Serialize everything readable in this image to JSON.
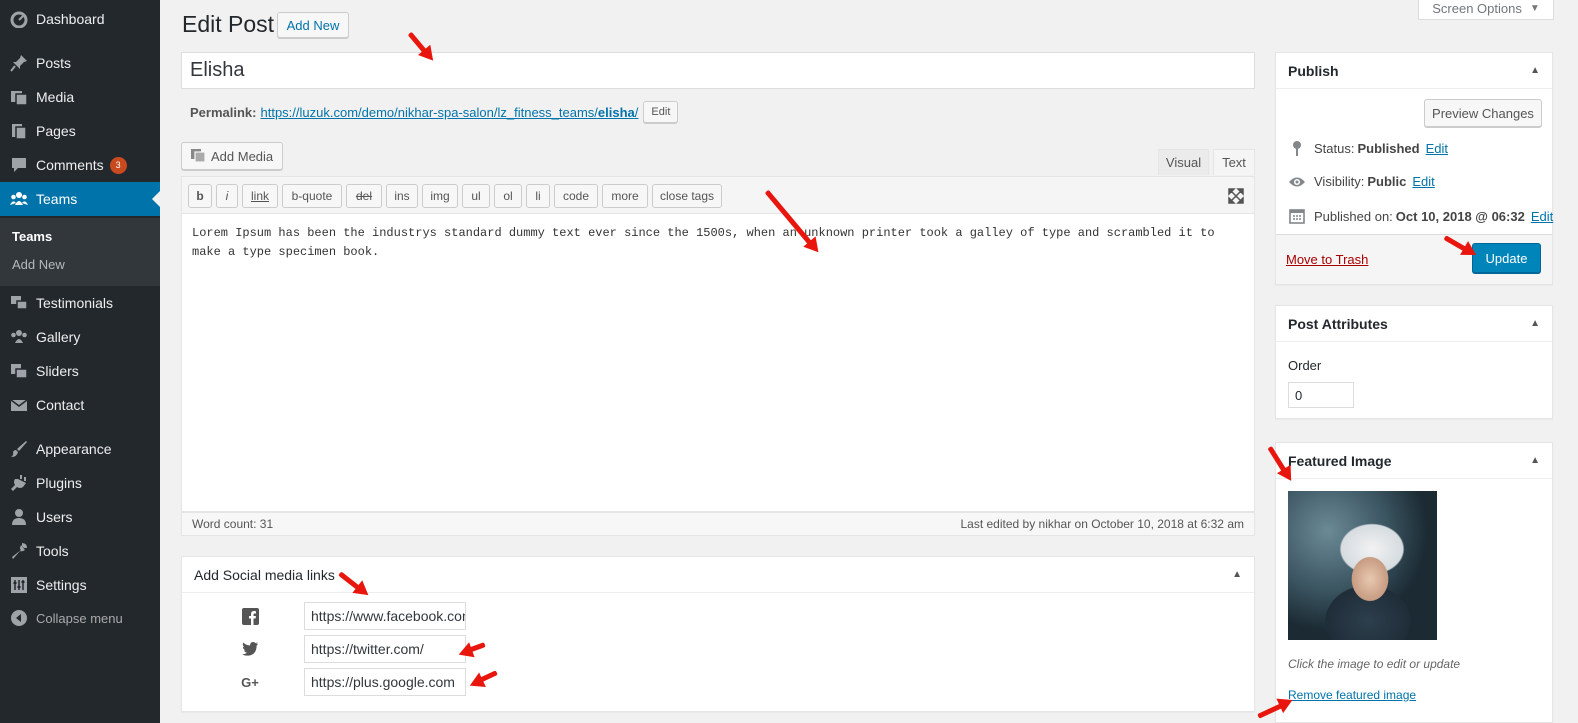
{
  "sidebar": {
    "items": [
      {
        "label": "Dashboard",
        "icon": "dashboard-icon"
      },
      {
        "label": "Posts",
        "icon": "pushpin-icon"
      },
      {
        "label": "Media",
        "icon": "media-icon"
      },
      {
        "label": "Pages",
        "icon": "pages-icon"
      },
      {
        "label": "Comments",
        "icon": "comment-icon",
        "badge": "3"
      },
      {
        "label": "Teams",
        "icon": "groups-icon"
      },
      {
        "label": "Testimonials",
        "icon": "testimonial-icon"
      },
      {
        "label": "Gallery",
        "icon": "gallery-icon"
      },
      {
        "label": "Sliders",
        "icon": "slides-icon"
      },
      {
        "label": "Contact",
        "icon": "envelope-icon"
      },
      {
        "label": "Appearance",
        "icon": "brush-icon"
      },
      {
        "label": "Plugins",
        "icon": "plugin-icon"
      },
      {
        "label": "Users",
        "icon": "user-icon"
      },
      {
        "label": "Tools",
        "icon": "wrench-icon"
      },
      {
        "label": "Settings",
        "icon": "settings-icon"
      }
    ],
    "submenu": [
      "Teams",
      "Add New"
    ],
    "collapse_label": "Collapse menu"
  },
  "header": {
    "title": "Edit Post",
    "add_new": "Add New",
    "screen_options": "Screen Options"
  },
  "post": {
    "title": "Elisha",
    "permalink_label": "Permalink:",
    "permalink_base": "https://luzuk.com/demo/nikhar-spa-salon/lz_fitness_teams/",
    "permalink_slug": "elisha",
    "permalink_end": "/",
    "permalink_edit": "Edit"
  },
  "editor": {
    "add_media": "Add Media",
    "tab_visual": "Visual",
    "tab_text": "Text",
    "buttons": [
      "b",
      "i",
      "link",
      "b-quote",
      "del",
      "ins",
      "img",
      "ul",
      "ol",
      "li",
      "code",
      "more",
      "close tags"
    ],
    "content": "Lorem Ipsum has been the industrys standard dummy text ever since the 1500s, when an unknown printer took a galley of type and scrambled it to make a type specimen book.",
    "word_count": "Word count: 31",
    "last_edited": "Last edited by nikhar on October 10, 2018 at 6:32 am"
  },
  "social": {
    "title": "Add Social media links",
    "links": [
      {
        "icon": "facebook-icon",
        "value": "https://www.facebook.com/"
      },
      {
        "icon": "twitter-icon",
        "value": "https://twitter.com/"
      },
      {
        "icon": "google-plus-icon",
        "value": "https://plus.google.com"
      }
    ]
  },
  "publish": {
    "title": "Publish",
    "preview": "Preview Changes",
    "status_label": "Status:",
    "status_value": "Published",
    "visibility_label": "Visibility:",
    "visibility_value": "Public",
    "published_label": "Published on:",
    "published_value": "Oct 10, 2018 @ 06:32",
    "edit": "Edit",
    "trash": "Move to Trash",
    "update": "Update"
  },
  "attributes": {
    "title": "Post Attributes",
    "order_label": "Order",
    "order_value": "0"
  },
  "featured": {
    "title": "Featured Image",
    "hint": "Click the image to edit or update",
    "remove": "Remove featured image"
  },
  "colors": {
    "sidebar_bg": "#23282d",
    "accent": "#0073aa",
    "primary_button": "#0085ba",
    "annotation_arrow": "#e8160c",
    "badge": "#ca4a1f"
  }
}
